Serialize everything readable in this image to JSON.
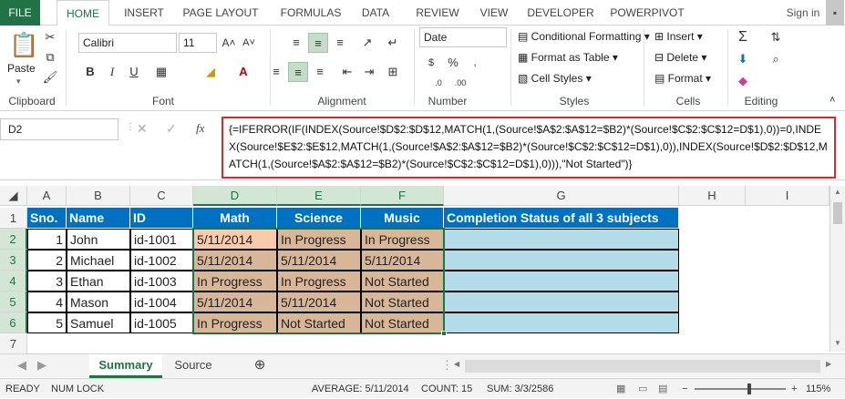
{
  "ribbon_tabs": [
    "FILE",
    "HOME",
    "INSERT",
    "PAGE LAYOUT",
    "FORMULAS",
    "DATA",
    "REVIEW",
    "VIEW",
    "DEVELOPER",
    "POWERPIVOT"
  ],
  "sign_in": "Sign in",
  "clipboard": {
    "paste": "Paste",
    "label": "Clipboard"
  },
  "font": {
    "name": "Calibri",
    "size": "11",
    "label": "Font"
  },
  "alignment": {
    "label": "Alignment"
  },
  "number": {
    "format": "Date",
    "label": "Number"
  },
  "styles": {
    "conditional": "Conditional Formatting",
    "format_table": "Format as Table",
    "cell_styles": "Cell Styles",
    "label": "Styles"
  },
  "cells": {
    "insert": "Insert",
    "delete": "Delete",
    "format": "Format",
    "label": "Cells"
  },
  "editing": {
    "label": "Editing"
  },
  "formula_bar": {
    "name_box": "D2",
    "fx": "fx",
    "formula": "{=IFERROR(IF(INDEX(Source!$D$2:$D$12,MATCH(1,(Source!$A$2:$A$12=$B2)*(Source!$C$2:$C$12=D$1),0))=0,INDEX(Source!$E$2:$E$12,MATCH(1,(Source!$A$2:$A$12=$B2)*(Source!$C$2:$C$12=D$1),0)),INDEX(Source!$D$2:$D$12,MATCH(1,(Source!$A$2:$A$12=$B2)*(Source!$C$2:$C$12=D$1),0))),\"Not Started\")}"
  },
  "columns": [
    "A",
    "B",
    "C",
    "D",
    "E",
    "F",
    "G",
    "H",
    "I"
  ],
  "rows": [
    "1",
    "2",
    "3",
    "4",
    "5",
    "6",
    "7"
  ],
  "header_row": [
    "Sno.",
    "Name",
    "ID",
    "Math",
    "Science",
    "Music",
    "Completion Status of all 3 subjects"
  ],
  "data_rows": [
    [
      "1",
      "John",
      "id-1001",
      "5/11/2014",
      "In Progress",
      "In Progress",
      ""
    ],
    [
      "2",
      "Michael",
      "id-1002",
      "5/11/2014",
      "5/11/2014",
      "5/11/2014",
      ""
    ],
    [
      "3",
      "Ethan",
      "id-1003",
      "In Progress",
      "In Progress",
      "Not Started",
      ""
    ],
    [
      "4",
      "Mason",
      "id-1004",
      "5/11/2014",
      "5/11/2014",
      "Not Started",
      ""
    ],
    [
      "5",
      "Samuel",
      "id-1005",
      "In Progress",
      "Not Started",
      "Not Started",
      ""
    ]
  ],
  "sheets": [
    "Summary",
    "Source"
  ],
  "status": {
    "ready": "READY",
    "numlock": "NUM LOCK",
    "average": "AVERAGE: 5/11/2014",
    "count": "COUNT: 15",
    "sum": "SUM: 3/3/2586",
    "zoom": "115%"
  },
  "colors": {
    "excel_green": "#217346",
    "header_blue": "#0070c0",
    "peach": "#f8cbad",
    "tan": "#d8b798",
    "light_blue": "#b4dbe8",
    "highlight_red": "#d9282e"
  }
}
